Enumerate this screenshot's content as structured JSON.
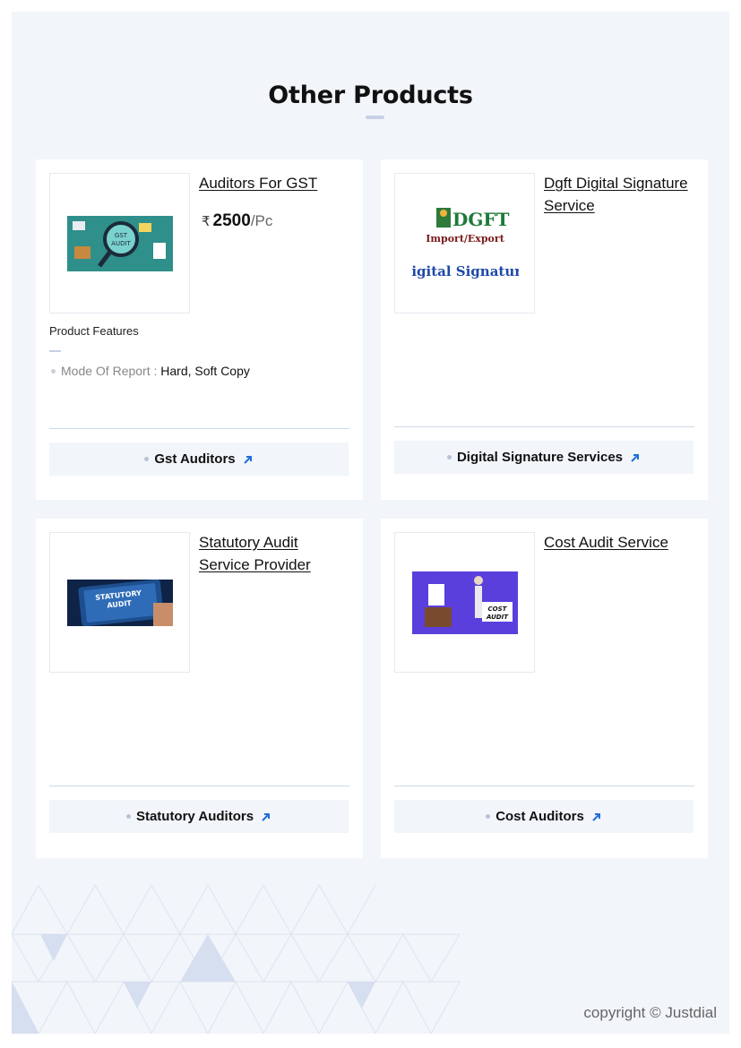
{
  "section": {
    "title": "Other Products"
  },
  "products": [
    {
      "name": "Auditors For GST",
      "price": {
        "currency": "₹",
        "amount": "2500",
        "unit": "/Pc"
      },
      "features_title": "Product Features",
      "features": [
        {
          "label": "Mode Of Report : ",
          "value": "Hard, Soft Copy"
        }
      ],
      "category": "Gst Auditors",
      "image": {
        "caption": "GST\nAUDIT",
        "bg": "#2f8f8a"
      }
    },
    {
      "name": "Dgft Digital Signature Service",
      "category": "Digital Signature Services",
      "image": {
        "logo_text": "DGFT",
        "line2": "Import/Export",
        "line3": "Digital Signature"
      }
    },
    {
      "name": "Statutory Audit Service Provider",
      "category": "Statutory Auditors",
      "image": {
        "caption": "STATUTORY AUDIT",
        "bg": "#1d4f8f"
      }
    },
    {
      "name": "Cost Audit Service",
      "category": "Cost Auditors",
      "image": {
        "caption": "COST AUDIT",
        "bg": "#5b3fdc"
      }
    }
  ],
  "footer": {
    "copyright": "copyright © Justdial"
  },
  "colors": {
    "page_bg": "#f2f5fa",
    "accent": "#1e6fd9",
    "divider": "#cdd9e8"
  }
}
